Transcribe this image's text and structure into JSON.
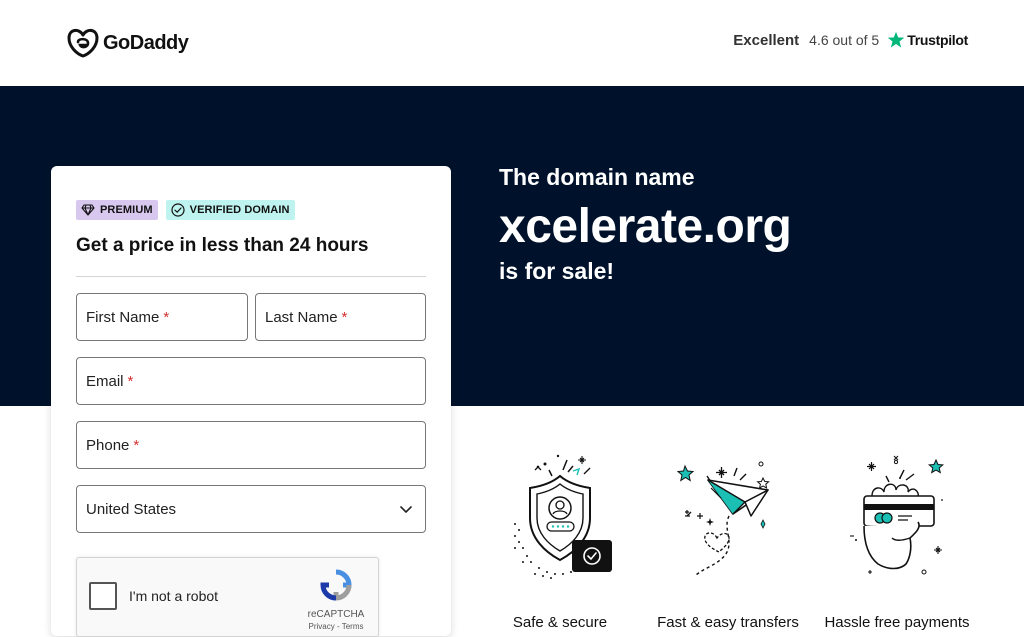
{
  "header": {
    "logo_text": "GoDaddy",
    "trust_label": "Excellent",
    "trust_rating": "4.6 out of 5",
    "trust_brand": "Trustpilot"
  },
  "hero": {
    "line1": "The domain name",
    "domain": "xcelerate.org",
    "line2": "is for sale!"
  },
  "form": {
    "badge_premium": "PREMIUM",
    "badge_verified": "VERIFIED DOMAIN",
    "title": "Get a price in less than 24 hours",
    "first_name": "First Name",
    "last_name": "Last Name",
    "email": "Email",
    "phone": "Phone",
    "required_mark": "*",
    "country": "United States",
    "captcha_label": "I'm not a robot",
    "captcha_brand": "reCAPTCHA",
    "captcha_links": "Privacy - Terms"
  },
  "features": [
    {
      "label": "Safe & secure",
      "icon": "shield-user-icon"
    },
    {
      "label": "Fast & easy transfers",
      "icon": "paper-plane-icon"
    },
    {
      "label": "Hassle free payments",
      "icon": "hand-card-icon"
    }
  ],
  "colors": {
    "hero_bg": "#00122b",
    "premium_bg": "#d8c8f0",
    "verified_bg": "#bff3ef",
    "accent_teal": "#1bbfb3",
    "trustpilot_green": "#00b67a",
    "required": "#d32f2f"
  }
}
